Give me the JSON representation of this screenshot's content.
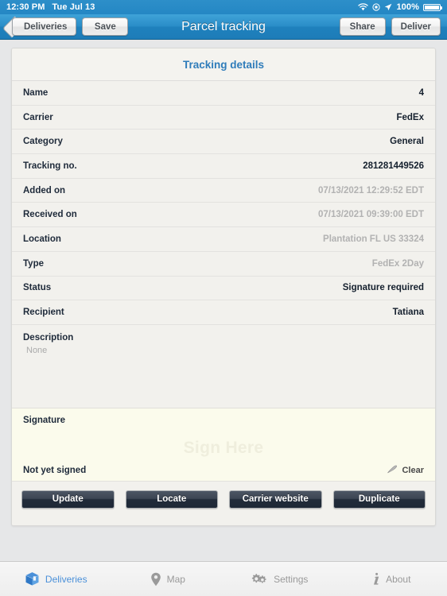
{
  "statusbar": {
    "time": "12:30 PM",
    "date": "Tue Jul 13",
    "battery_pct": "100%",
    "icons": [
      "wifi-icon",
      "rotation-lock-icon",
      "location-arrow-icon",
      "battery-icon"
    ]
  },
  "navbar": {
    "back_label": "Deliveries",
    "save_label": "Save",
    "title": "Parcel tracking",
    "share_label": "Share",
    "deliver_label": "Deliver"
  },
  "details": {
    "header": "Tracking details",
    "rows": [
      {
        "key": "Name",
        "value": "4",
        "muted": false
      },
      {
        "key": "Carrier",
        "value": "FedEx",
        "muted": false
      },
      {
        "key": "Category",
        "value": "General",
        "muted": false
      },
      {
        "key": "Tracking no.",
        "value": "281281449526",
        "muted": false
      },
      {
        "key": "Added on",
        "value": "07/13/2021 12:29:52 EDT",
        "muted": true
      },
      {
        "key": "Received on",
        "value": "07/13/2021 09:39:00 EDT",
        "muted": true
      },
      {
        "key": "Location",
        "value": "Plantation FL US 33324",
        "muted": true
      },
      {
        "key": "Type",
        "value": "FedEx 2Day",
        "muted": true
      },
      {
        "key": "Status",
        "value": "Signature required",
        "muted": false
      },
      {
        "key": "Recipient",
        "value": "Tatiana",
        "muted": false
      }
    ],
    "description_label": "Description",
    "description_value": "None"
  },
  "signature": {
    "label": "Signature",
    "placeholder": "Sign Here",
    "status": "Not yet signed",
    "clear_label": "Clear",
    "clear_icon": "pencil-icon",
    "background": "#fbfbec"
  },
  "actions": [
    {
      "label": "Update"
    },
    {
      "label": "Locate"
    },
    {
      "label": "Carrier website"
    },
    {
      "label": "Duplicate"
    }
  ],
  "tabbar": {
    "items": [
      {
        "label": "Deliveries",
        "icon": "box-icon",
        "active": true
      },
      {
        "label": "Map",
        "icon": "pin-icon",
        "active": false
      },
      {
        "label": "Settings",
        "icon": "gears-icon",
        "active": false
      },
      {
        "label": "About",
        "icon": "info-i-icon",
        "active": false
      }
    ],
    "active_color": "#4a90d9",
    "inactive_color": "#9a9a9a"
  },
  "theme": {
    "navbar_blue": "#2a8dc8",
    "header_blue": "#2f7cba",
    "card_bg": "#f2f1ed",
    "signature_bg": "#fbfbec",
    "button_dark": "#222c3a"
  }
}
